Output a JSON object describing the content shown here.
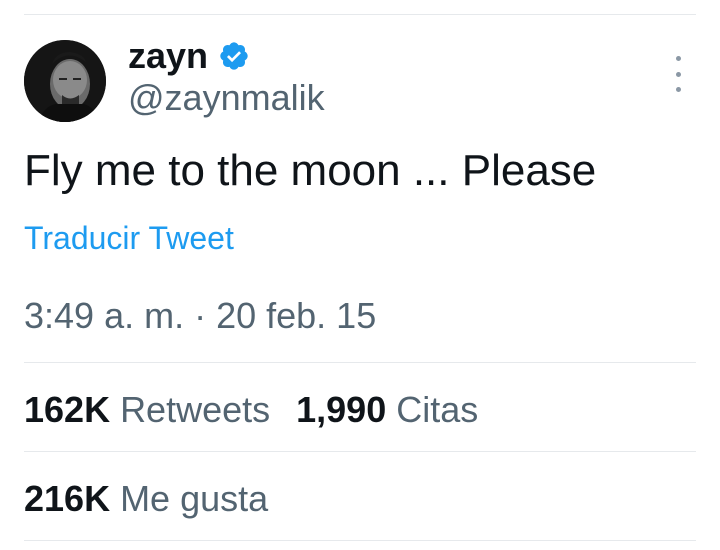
{
  "tweet": {
    "author": {
      "display_name": "zayn",
      "handle": "@zaynmalik",
      "verified": true,
      "verified_color": "#1d9bf0"
    },
    "text": "Fly me to the moon ... Please",
    "translate_label": "Traducir Tweet",
    "timestamp": "3:49 a. m. · 20 feb. 15",
    "stats": {
      "retweets_count": "162K",
      "retweets_label": "Retweets",
      "quotes_count": "1,990",
      "quotes_label": "Citas",
      "likes_count": "216K",
      "likes_label": "Me gusta"
    }
  },
  "icons": {
    "verified": "verified-badge-icon",
    "more": "more-vertical-icon"
  },
  "colors": {
    "text_primary": "#0f1419",
    "text_secondary": "#536471",
    "link": "#1d9bf0",
    "divider": "#e6e9ec"
  }
}
